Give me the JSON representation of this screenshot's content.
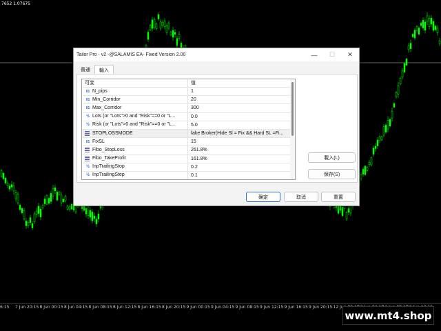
{
  "chart": {
    "price_label": "7652 1.07675",
    "candle_color": "#00ff00",
    "background": "#000000",
    "time_labels": [
      "6:15",
      "7 Jun 20:15",
      "8 Jun 00:15",
      "8 Jun 04:15",
      "8 Jun 08:15",
      "8 Jun 12:15",
      "8 Jun 16:15",
      "8 Jun 20:15",
      "9 Jun 00:15",
      "9 Jun 04:15",
      "9 Jun 08:15",
      "9 Jun 12:15",
      "9 Jun 16:15",
      "9 Jun 20:15",
      "12 Jun 00:15",
      "12 Jun 04:15",
      "12 Jun 08:15",
      "12 Jun 12:15"
    ],
    "watermark": "www.mt4.shop"
  },
  "dialog": {
    "title": "Tailor Pro - v2 -@SALAMIS EA- Fixed Version 2.00",
    "controls": {
      "minimize": "—",
      "maximize": "☐",
      "close": "✕"
    },
    "tabs": [
      {
        "label": "普通"
      },
      {
        "label": "輸入"
      }
    ],
    "grid": {
      "headers": {
        "variable": "可变",
        "value": "值"
      },
      "rows": [
        {
          "icon": "01",
          "name": "N_pips",
          "value": "1"
        },
        {
          "icon": "01",
          "name": "Min_Corridor",
          "value": "20"
        },
        {
          "icon": "01",
          "name": "Max_Corridor",
          "value": "300"
        },
        {
          "icon": "½",
          "name": "Lots (or \"Lots\">0 and \"Risk\"==0 or \"L...",
          "value": "0.0"
        },
        {
          "icon": "½",
          "name": "Risk (or \"Lots\">0 and \"Risk\"==0 or \"L...",
          "value": "5.0"
        },
        {
          "icon": "list",
          "name": "STOPLOSSMODE",
          "value": "fake Broker(Hide Sl = Fix && Hard SL =Fi..."
        },
        {
          "icon": "01",
          "name": "FixSL",
          "value": "15"
        },
        {
          "icon": "list",
          "name": "Fibo_StopLoss",
          "value": "261.8%"
        },
        {
          "icon": "list",
          "name": "Fibo_TakeProfit",
          "value": "161.8%"
        },
        {
          "icon": "½",
          "name": "InpTrailingStop",
          "value": "0.2"
        },
        {
          "icon": "½",
          "name": "InpTrailingStep",
          "value": "0.1"
        }
      ]
    },
    "side_buttons": {
      "load": "載入(L)",
      "save": "保存(S)"
    },
    "footer": {
      "ok": "确定",
      "cancel": "取消",
      "reset": "重置"
    }
  }
}
